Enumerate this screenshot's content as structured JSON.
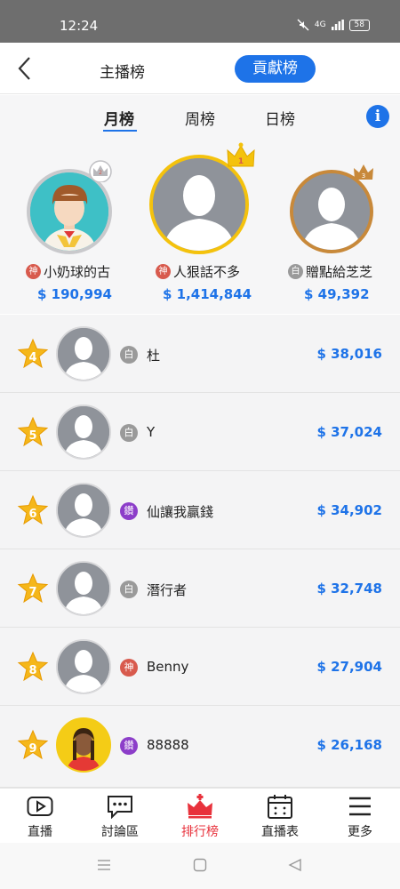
{
  "status": {
    "time": "12:24",
    "network": "4G",
    "battery": "58"
  },
  "header": {
    "tab_streamer": "主播榜",
    "tab_contributor": "貢獻榜"
  },
  "period_tabs": [
    "月榜",
    "周榜",
    "日榜"
  ],
  "info_icon": "i",
  "podium": [
    {
      "rank": 2,
      "badge": "神",
      "badge_type": "shen",
      "name": "小奶球的古",
      "amount": "$ 190,994",
      "avatar": "cartoon-boy",
      "crown_color": "#c0c0c4"
    },
    {
      "rank": 1,
      "badge": "神",
      "badge_type": "shen",
      "name": "人狠話不多",
      "amount": "$ 1,414,844",
      "avatar": "default",
      "crown_color": "#f4c20d"
    },
    {
      "rank": 3,
      "badge": "白",
      "badge_type": "bai",
      "name": "贈點給芝芝",
      "amount": "$ 49,392",
      "avatar": "default",
      "crown_color": "#c8893a"
    }
  ],
  "ranking": [
    {
      "rank": "4",
      "badge": "白",
      "badge_type": "bai",
      "name": "杜",
      "amount": "$ 38,016",
      "avatar": "default"
    },
    {
      "rank": "5",
      "badge": "白",
      "badge_type": "bai",
      "name": "Y",
      "amount": "$ 37,024",
      "avatar": "default"
    },
    {
      "rank": "6",
      "badge": "鑽",
      "badge_type": "zuan",
      "name": "仙讓我贏錢",
      "amount": "$ 34,902",
      "avatar": "default"
    },
    {
      "rank": "7",
      "badge": "白",
      "badge_type": "bai",
      "name": "潛行者",
      "amount": "$ 32,748",
      "avatar": "default"
    },
    {
      "rank": "8",
      "badge": "神",
      "badge_type": "shen",
      "name": "Benny",
      "amount": "$ 27,904",
      "avatar": "default"
    },
    {
      "rank": "9",
      "badge": "鑽",
      "badge_type": "zuan",
      "name": "88888",
      "amount": "$ 26,168",
      "avatar": "cartoon-girl"
    }
  ],
  "tabbar": [
    {
      "label": "直播",
      "icon": "play-icon"
    },
    {
      "label": "討論區",
      "icon": "chat-icon"
    },
    {
      "label": "排行榜",
      "icon": "crown-icon",
      "active": true
    },
    {
      "label": "直播表",
      "icon": "calendar-icon"
    },
    {
      "label": "更多",
      "icon": "menu-icon"
    }
  ],
  "colors": {
    "accent": "#1e73e8",
    "active_tab": "#e8323c",
    "gold": "#f4c20d"
  }
}
